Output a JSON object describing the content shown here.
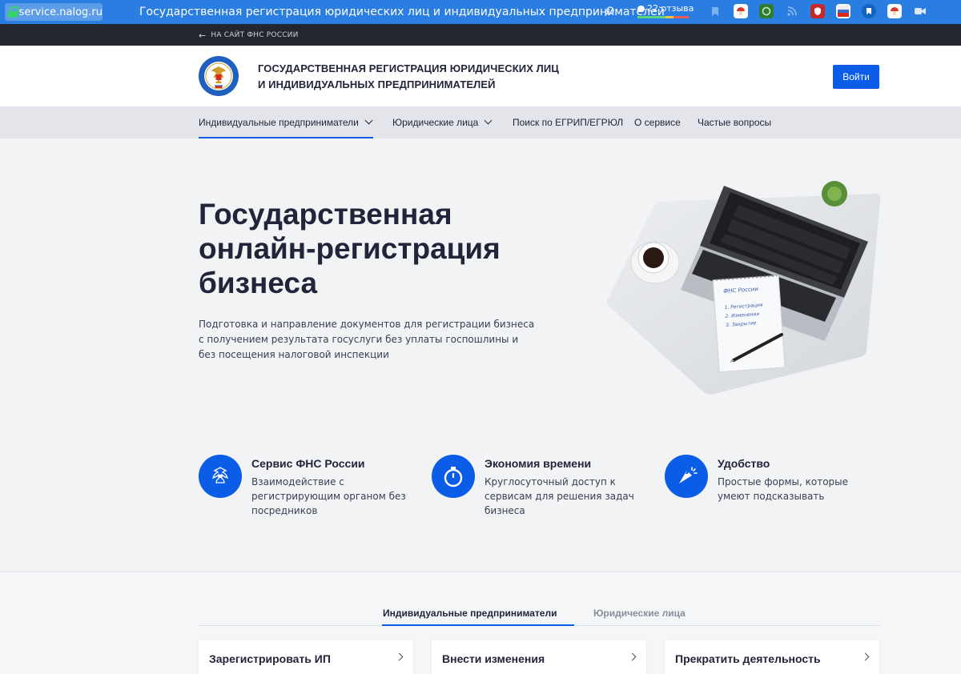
{
  "browser": {
    "url": "service.nalog.ru",
    "tab_title": "Государственная регистрация юридических лиц и индивидуальных предпринимателей",
    "reviews_label": "22 отзыва"
  },
  "back_link": "НА САЙТ ФНС РОССИИ",
  "header": {
    "title_line1": "ГОСУДАРСТВЕННАЯ РЕГИСТРАЦИЯ ЮРИДИЧЕСКИХ ЛИЦ",
    "title_line2": "И ИНДИВИДУАЛЬНЫХ ПРЕДПРИНИМАТЕЛЕЙ",
    "login_label": "Войти"
  },
  "nav": {
    "items": [
      {
        "label": "Индивидуальные предприниматели"
      },
      {
        "label": "Юридические лица"
      },
      {
        "label": "Поиск по ЕГРИП/ЕГРЮЛ"
      },
      {
        "label": "О сервисе"
      },
      {
        "label": "Частые вопросы"
      }
    ]
  },
  "hero": {
    "title_line1": "Государственная",
    "title_line2": "онлайн-регистрация",
    "title_line3": "бизнеса",
    "subtitle": "Подготовка и направление документов для регистрации бизнеса с получением результата госуслуги без уплаты госпошлины и без посещения налоговой инспекции",
    "notepad_heading": "ФНС России",
    "notepad_items": [
      "1. Регистрация",
      "2. Изменения",
      "3. Закрытие"
    ]
  },
  "features": [
    {
      "title": "Сервис ФНС России",
      "text": "Взаимодействие с регистрирующим органом без посредников",
      "icon": "eagle-emblem-icon"
    },
    {
      "title": "Экономия времени",
      "text": "Круглосуточный доступ к сервисам для решения задач бизнеса",
      "icon": "stopwatch-icon"
    },
    {
      "title": "Удобство",
      "text": "Простые формы, которые умеют подсказывать",
      "icon": "cursor-click-icon"
    }
  ],
  "section_tabs": [
    {
      "label": "Индивидуальные предприниматели"
    },
    {
      "label": "Юридические лица"
    }
  ],
  "action_cards": [
    {
      "label": "Зарегистрировать ИП"
    },
    {
      "label": "Внести изменения"
    },
    {
      "label": "Прекратить деятельность"
    }
  ],
  "colors": {
    "brand_blue": "#0b5ce6",
    "browser_blue": "#2a7de1",
    "dark_strip": "#23262f",
    "nav_bg": "#e3e5ea"
  }
}
